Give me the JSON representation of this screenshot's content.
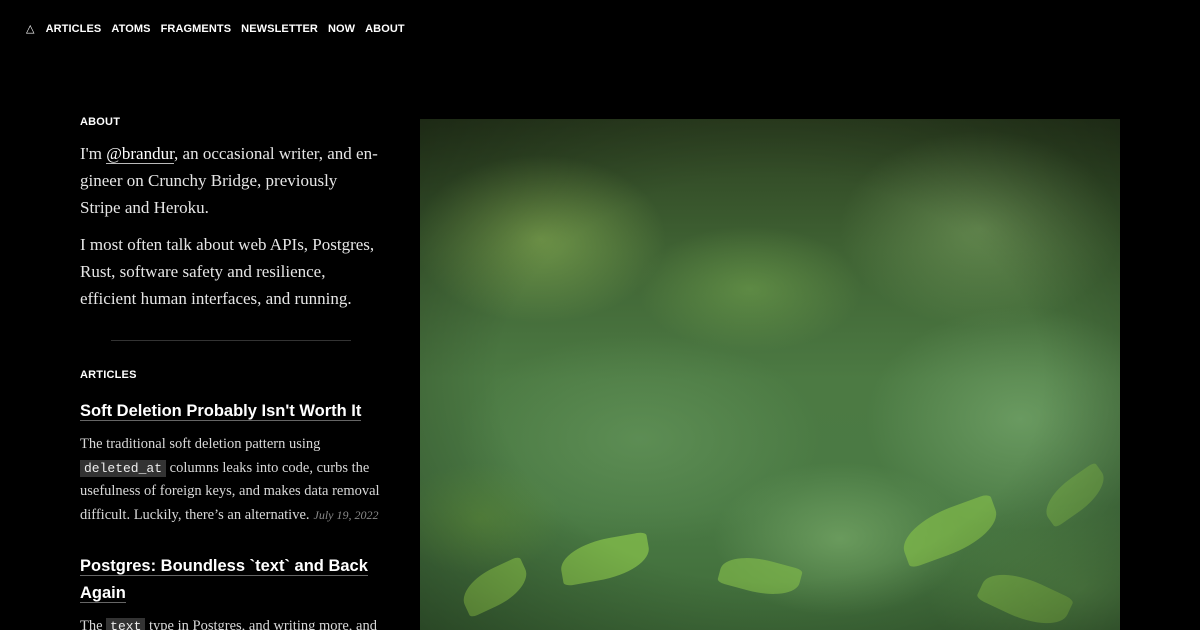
{
  "nav": {
    "home_icon": "△",
    "items": [
      "ARTICLES",
      "ATOMS",
      "FRAGMENTS",
      "NEWSLETTER",
      "NOW",
      "ABOUT"
    ]
  },
  "about": {
    "label": "ABOUT",
    "p1_before": "I'm ",
    "p1_handle": "@brandur",
    "p1_after": ", an occasional writer, and en­gineer on Crunchy Bridge, previously Stripe and Heroku.",
    "p2": "I most often talk about web APIs, Postgres, Rust, software safety and resilience, efficient human interfaces, and running."
  },
  "articles": {
    "label": "ARTICLES",
    "items": [
      {
        "title": "Soft Deletion Probably Isn't Worth It",
        "desc_before": "The traditional soft deletion pattern using ",
        "desc_code": "deleted_at",
        "desc_after": " columns leaks into code, curbs the usefulness of foreign keys, and makes data removal difficult. Luckily, there’s an alternative.",
        "date": "July 19, 2022"
      },
      {
        "title": "Postgres: Boundless `text` and Back Again",
        "desc_before": "The ",
        "desc_code": "text",
        "desc_after": " type in Postgres, and writing more, and",
        "date": ""
      }
    ]
  },
  "hero": {
    "icon": "fern-photo-image",
    "colors": {
      "base": "#4c7a43",
      "highlight": "#7fb84a"
    }
  }
}
